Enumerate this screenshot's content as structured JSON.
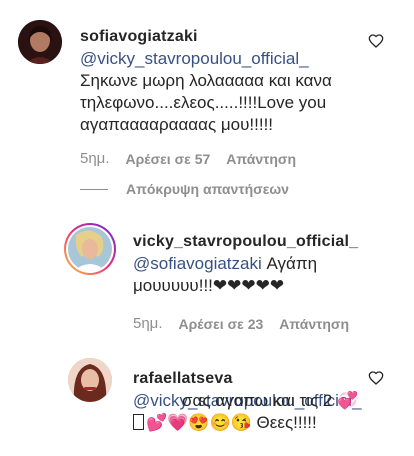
{
  "comments": [
    {
      "username": "sofiavogiatzaki",
      "mention": "@vicky_stavropoulou_official_",
      "text": "Σηκωνε μωρη λολααααα και κανα τηλεφωνο....ελεος.....!!!!Love you αγαπααααραααας μου!!!!!",
      "time": "5ημ.",
      "likes": "Αρέσει σε 57",
      "reply": "Απάντηση"
    },
    {
      "username": "vicky_stavropoulou_official_",
      "mention": "@sofiavogiatzaki",
      "text": "Αγάπη μουυυυυ!!!❤❤❤❤❤",
      "time": "5ημ.",
      "likes": "Αρέσει σε 23",
      "reply": "Απάντηση"
    },
    {
      "username": "rafaellatseva",
      "mention": "@vicky_stavropoulou_official_",
      "text": "σας αγαπω και τις 2 💞",
      "text_line3": "💕💗😍😊😘 Θεες!!!!!"
    }
  ],
  "hide_replies": "Απόκρυψη απαντήσεων",
  "icons": {
    "like": "heart-outline-icon"
  },
  "colors": {
    "mention": "#385185",
    "meta": "#8e8e8e"
  }
}
